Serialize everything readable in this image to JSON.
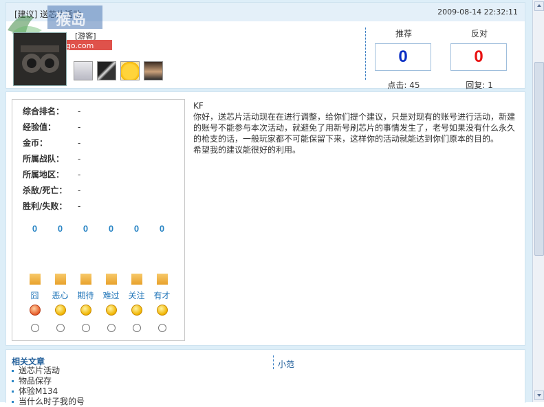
{
  "post": {
    "title": "[建议] 送芯片活动",
    "date": "2009-08-14 22:32:11",
    "author_role": "[游客]"
  },
  "logo": {
    "text": "bbs.haudgo.com"
  },
  "votes": {
    "recommend_label": "推荐",
    "recommend_value": "0",
    "oppose_label": "反对",
    "oppose_value": "0",
    "clicks": "点击: 45",
    "replies": "回复: 1"
  },
  "profile": {
    "stats": [
      {
        "label": "综合排名：",
        "value": "-"
      },
      {
        "label": "经验值：",
        "value": "-"
      },
      {
        "label": "金币：",
        "value": "-"
      },
      {
        "label": "所属战队：",
        "value": "-"
      },
      {
        "label": "所属地区：",
        "value": "-"
      },
      {
        "label": "杀敌/死亡：",
        "value": "-"
      },
      {
        "label": "胜利/失败：",
        "value": "-"
      }
    ],
    "moods": [
      {
        "label": "囧",
        "count": "0",
        "icon": "embarrassed-face-icon"
      },
      {
        "label": "恶心",
        "count": "0",
        "icon": "sick-face-icon"
      },
      {
        "label": "期待",
        "count": "0",
        "icon": "hopeful-face-icon"
      },
      {
        "label": "难过",
        "count": "0",
        "icon": "sad-face-icon"
      },
      {
        "label": "关注",
        "count": "0",
        "icon": "watching-face-icon"
      },
      {
        "label": "有才",
        "count": "0",
        "icon": "talented-face-icon"
      }
    ]
  },
  "body": {
    "author": "KF",
    "paragraph1": "你好，送芯片活动现在在进行调整，给你们提个建议，只是对现有的账号进行活动，新建的账号不能参与本次活动，就避免了用新号刷芯片的事情发生了，老号如果没有什么永久的枪支的话，一般玩家都不可能保留下来，这样你的活动就能达到你们原本的目的。",
    "paragraph2": "希望我的建议能很好的利用。"
  },
  "related": {
    "title": "相关文章",
    "items": [
      "送芯片活动",
      "物品保存",
      "体验M134",
      "当什么时子我的号"
    ],
    "right_link": "小范"
  },
  "colors": {
    "recommend": "#0b2fc4",
    "oppose": "#e81212",
    "accent": "#2b86c5",
    "frame_bg": "#ddeef8"
  }
}
